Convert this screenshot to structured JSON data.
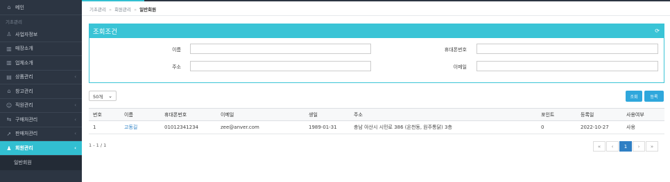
{
  "sidebar": {
    "home": "메인",
    "section_basic": "기초관리",
    "items": [
      {
        "label": "사업자정보"
      },
      {
        "label": "매장소개"
      },
      {
        "label": "업체소개"
      },
      {
        "label": "상품관리"
      },
      {
        "label": "창고관리"
      },
      {
        "label": "직원관리"
      },
      {
        "label": "구매처관리"
      },
      {
        "label": "판매처관리"
      },
      {
        "label": "회원관리"
      }
    ],
    "subitem": "일반회원"
  },
  "breadcrumb": {
    "level1": "기초관리",
    "level2": "회원관리",
    "current": "일반회원",
    "separator": "»"
  },
  "search_panel": {
    "title": "조회조건",
    "name_label": "이름",
    "phone_label": "휴대폰번호",
    "address_label": "주소",
    "email_label": "이메일"
  },
  "controls": {
    "page_size": "50개",
    "search_button": "조회",
    "register_button": "등록"
  },
  "table": {
    "headers": [
      "번호",
      "이름",
      "휴대폰번호",
      "이메일",
      "생일",
      "주소",
      "포인트",
      "등록일",
      "사용여부"
    ],
    "rows": [
      [
        "1",
        "고동길",
        "01012341234",
        "zee@anver.com",
        "1989-01-31",
        "충남 아산시 시민로 386 (온천동, 원주통닭) 3층",
        "0",
        "2022-10-27",
        "사용"
      ]
    ]
  },
  "pagination": {
    "info": "1 - 1 / 1",
    "first": "«",
    "prev": "‹",
    "current": "1",
    "next": "›",
    "last": "»"
  }
}
